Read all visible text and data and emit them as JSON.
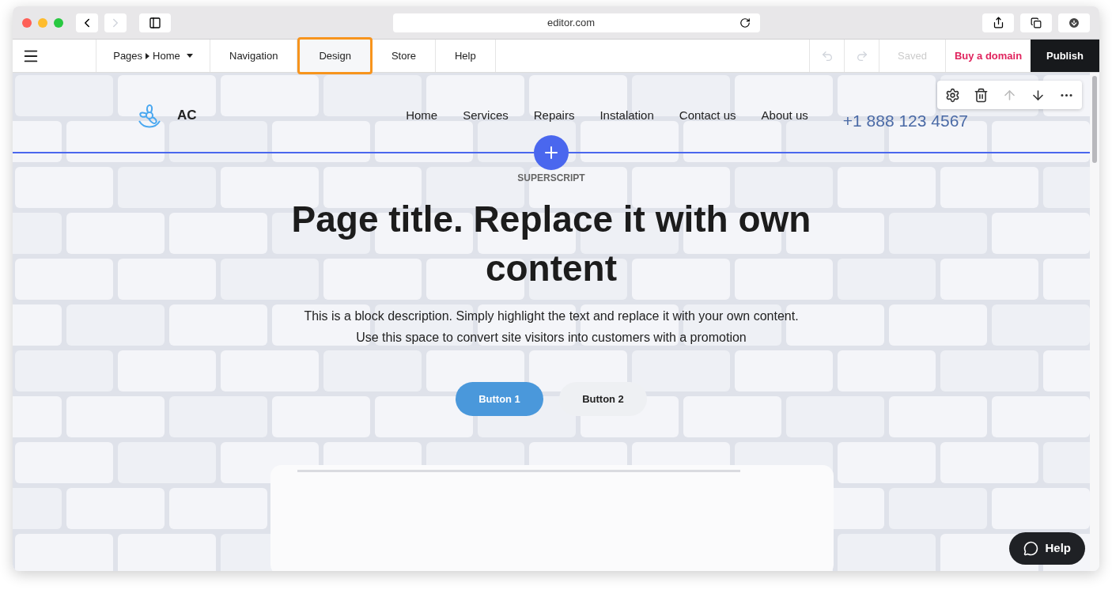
{
  "browser": {
    "url": "editor.com"
  },
  "editor_toolbar": {
    "pages_label": "Pages",
    "page": "Home",
    "tabs": [
      {
        "label": "Navigation",
        "selected": false
      },
      {
        "label": "Design",
        "selected": true
      },
      {
        "label": "Store",
        "selected": false
      },
      {
        "label": "Help",
        "selected": false
      }
    ],
    "undo_disabled": true,
    "redo_disabled": true,
    "save_status": {
      "label": "Saved",
      "disabled": true
    },
    "buy_domain": "Buy a domain",
    "publish": "Publish"
  },
  "site_header": {
    "logo_text": "AC",
    "nav": [
      "Home",
      "Services",
      "Repairs",
      "Instalation",
      "Contact us",
      "About us"
    ],
    "phone": "+1 888 123 4567"
  },
  "block_toolbar": {
    "move_up_disabled": true,
    "move_down_disabled": false
  },
  "hero": {
    "superscript": "SUPERSCRIPT",
    "title": "Page title. Replace it with own content",
    "description": [
      "This is a block description. Simply highlight the text and replace it with your own content.",
      "Use this space to convert site visitors into customers with a promotion"
    ],
    "buttons": [
      {
        "label": "Button 1",
        "kind": "primary"
      },
      {
        "label": "Button 2",
        "kind": "secondary"
      }
    ]
  },
  "help_button": "Help"
}
